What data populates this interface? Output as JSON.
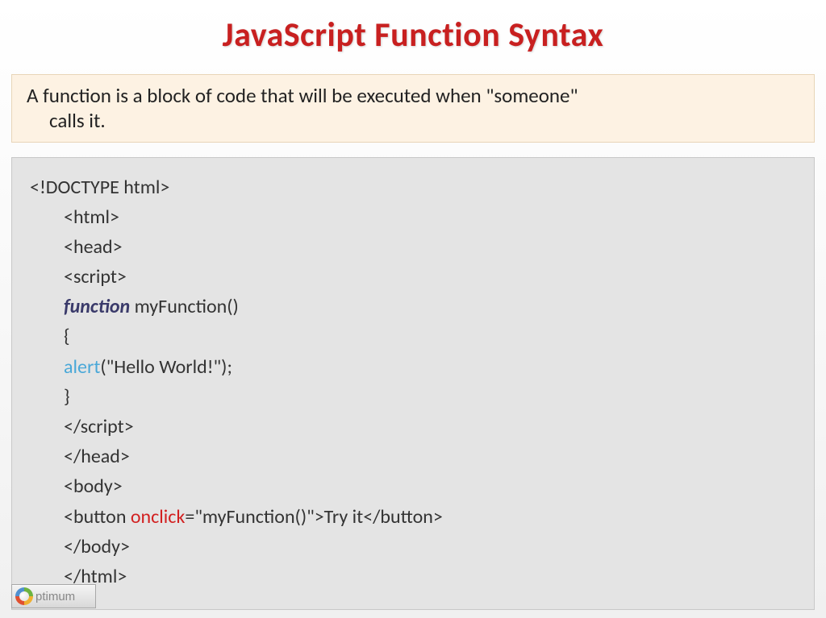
{
  "title": "JavaScript Function Syntax",
  "description": {
    "line1": "A function is a block of code that will be executed when \"someone\"",
    "line2": "calls it."
  },
  "code": {
    "l1": "<!DOCTYPE html>",
    "l2": "<html>",
    "l3": "<head>",
    "l4": "<script>",
    "l5a": "function",
    "l5b": " myFunction()",
    "l6": "{",
    "l7a": "alert",
    "l7b": "(\"Hello World!\");",
    "l8": "}",
    "l9": "</script>",
    "l10": "</head>",
    "l11": "<body>",
    "l12a": "<button ",
    "l12b": "onclick",
    "l12c": "=\"myFunction()\">Try it</button>",
    "l13": "</body>",
    "l14": "</html>"
  },
  "logo": {
    "text": "ptimum"
  }
}
